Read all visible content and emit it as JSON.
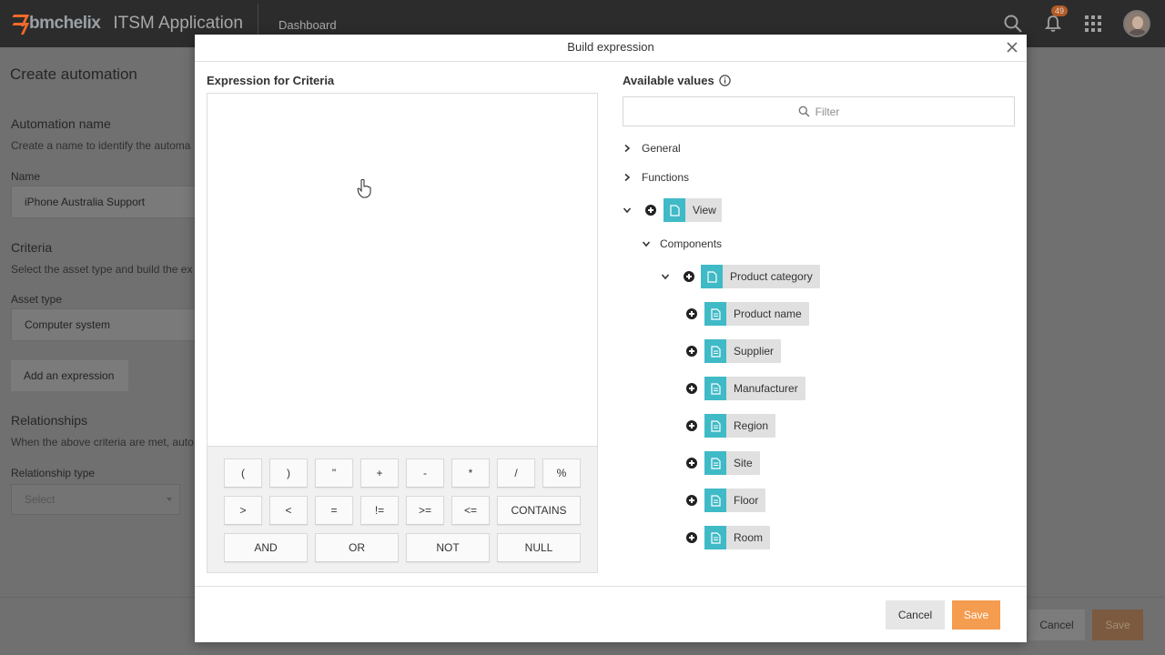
{
  "header": {
    "logo_text": "bmchelix",
    "app_title": "ITSM Application",
    "nav_item": "Dashboard",
    "notification_count": "49"
  },
  "background_page": {
    "title": "Create automation",
    "automation_name_section": "Automation name",
    "automation_name_desc": "Create a name to identify the automa",
    "name_label": "Name",
    "name_value": "iPhone Australia Support",
    "criteria_section": "Criteria",
    "criteria_desc": "Select the asset type and build the ex",
    "asset_type_label": "Asset type",
    "asset_type_value": "Computer system",
    "add_expression_label": "Add an expression",
    "relationships_section": "Relationships",
    "relationships_desc": "When the above criteria are met, auto",
    "relationship_type_label": "Relationship type",
    "relationship_type_placeholder": "Select",
    "cancel_label": "Cancel",
    "save_label": "Save"
  },
  "modal": {
    "title": "Build expression",
    "expression_title": "Expression for Criteria",
    "available_values_title": "Available values",
    "filter_placeholder": "Filter",
    "operators_row1": [
      "(",
      ")",
      "\"",
      "+",
      "-",
      "*",
      "/",
      "%"
    ],
    "operators_row2": [
      ">",
      "<",
      "=",
      "!=",
      ">=",
      "<=",
      "CONTAINS"
    ],
    "operators_row3": [
      "AND",
      "OR",
      "NOT",
      "NULL"
    ],
    "tree": {
      "general": "General",
      "functions": "Functions",
      "view": "View",
      "components": "Components",
      "product_category": "Product category",
      "fields": [
        "Product name",
        "Supplier",
        "Manufacturer",
        "Region",
        "Site",
        "Floor",
        "Room"
      ]
    },
    "cancel_label": "Cancel",
    "save_label": "Save"
  },
  "colors": {
    "accent_orange": "#f49c4f",
    "chip_teal": "#3fbac6",
    "header_bg": "#2c2c2c"
  }
}
